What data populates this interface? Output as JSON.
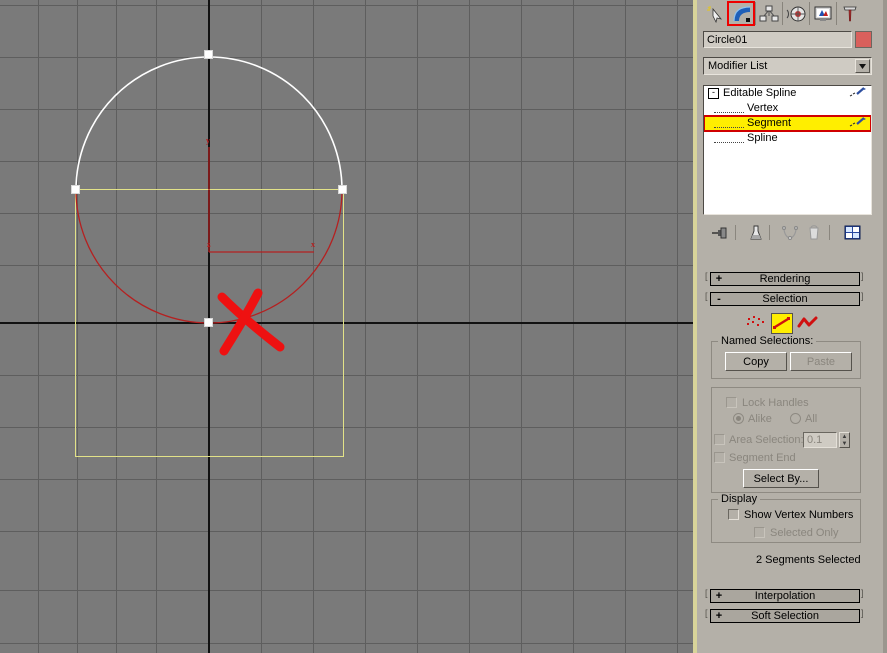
{
  "viewport": {
    "name": "perspective-viewport",
    "background_color": "#7a7a7a",
    "grid_color": "#5e5e5e",
    "axis_color": "#111111",
    "active_border_color": "#d8d49a",
    "object_color_unselected": "#ffffff",
    "object_color_selected": "#b52020",
    "selection_bbox_color": "#e2e288",
    "gizmo": {
      "x_label": "x",
      "y_label": "y",
      "origin_label": "z"
    },
    "annotation": {
      "name": "red-x-mark",
      "color": "#ee1111"
    }
  },
  "panel": {
    "tabs": [
      {
        "name": "create-tab",
        "icon": "star-arrow-icon",
        "active": false
      },
      {
        "name": "modify-tab",
        "icon": "bent-arc-icon",
        "active": true
      },
      {
        "name": "hierarchy-tab",
        "icon": "hierarchy-nodes-icon",
        "active": false
      },
      {
        "name": "motion-tab",
        "icon": "wheel-icon",
        "active": false
      },
      {
        "name": "display-tab",
        "icon": "monitor-icon",
        "active": false
      },
      {
        "name": "utilities-tab",
        "icon": "hammer-icon",
        "active": false
      }
    ],
    "object_name": "Circle01",
    "object_color": "#d9605c",
    "modifier_list_label": "Modifier List",
    "stack": [
      {
        "label": "Editable Spline",
        "level": 0,
        "selected": false,
        "expander": "-"
      },
      {
        "label": "Vertex",
        "level": 1,
        "selected": false
      },
      {
        "label": "Segment",
        "level": 1,
        "selected": true
      },
      {
        "label": "Spline",
        "level": 1,
        "selected": false
      }
    ],
    "stack_tools": [
      {
        "name": "pin-stack-button",
        "icon": "pin-icon"
      },
      {
        "name": "show-end-result-button",
        "icon": "flask-icon"
      },
      {
        "name": "make-unique-button",
        "icon": "necklace-icon"
      },
      {
        "name": "remove-modifier-button",
        "icon": "trash-icon"
      },
      {
        "name": "configure-modifier-sets-button",
        "icon": "config-sets-icon"
      }
    ],
    "rollouts": [
      {
        "name": "rendering-rollout",
        "sign": "+",
        "title": "Rendering",
        "open": false
      },
      {
        "name": "selection-rollout",
        "sign": "-",
        "title": "Selection",
        "open": true
      },
      {
        "name": "interpolation-rollout",
        "sign": "+",
        "title": "Interpolation",
        "open": false
      },
      {
        "name": "soft-selection-rollout",
        "sign": "+",
        "title": "Soft Selection",
        "open": false
      }
    ],
    "selection": {
      "sub_object_buttons": [
        {
          "name": "vertex-sub-object-button",
          "icon": "vertex-dots-icon",
          "active": false
        },
        {
          "name": "segment-sub-object-button",
          "icon": "segment-line-icon",
          "active": true
        },
        {
          "name": "spline-sub-object-button",
          "icon": "spline-zigzag-icon",
          "active": false
        }
      ],
      "named_selections_group": "Named Selections:",
      "copy_label": "Copy",
      "paste_label": "Paste",
      "lock_handles_label": "Lock Handles",
      "alike_label": "Alike",
      "all_label": "All",
      "area_selection_label": "Area Selection:",
      "area_selection_value": "0.1",
      "segment_end_label": "Segment End",
      "select_by_label": "Select By...",
      "display_group": "Display",
      "show_vertex_numbers_label": "Show Vertex Numbers",
      "selected_only_label": "Selected Only",
      "status_text": "2 Segments Selected"
    }
  }
}
